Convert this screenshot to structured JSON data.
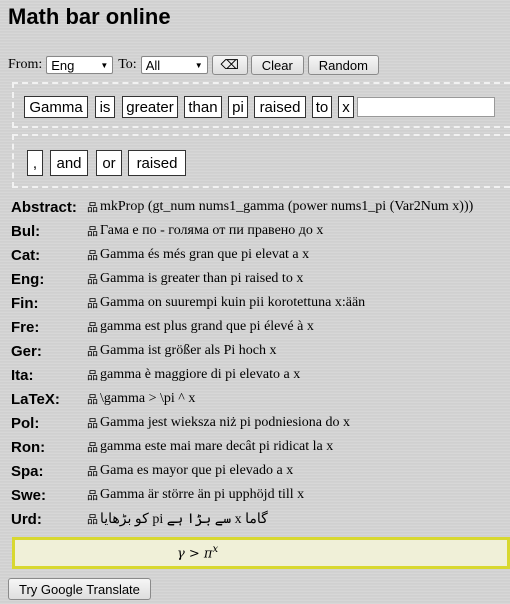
{
  "app": {
    "title": "Math bar online"
  },
  "controls": {
    "from_label": "From:",
    "from_value": "Eng",
    "to_label": "To:",
    "to_value": "All",
    "backspace_label": "⌫",
    "clear_label": "Clear",
    "random_label": "Random"
  },
  "sentence_words": [
    "Gamma",
    "is",
    "greater",
    "than",
    "pi",
    "raised",
    "to",
    "x"
  ],
  "next_words": [
    ",",
    "and",
    "or",
    "raised"
  ],
  "translations": [
    {
      "label": "Abstract:",
      "text": "mkProp (gt_num nums1_gamma (power nums1_pi (Var2Num x)))"
    },
    {
      "label": "Bul:",
      "text": "Гама е по - голяма от пи правено до x"
    },
    {
      "label": "Cat:",
      "text": "Gamma és més gran que pi elevat a x"
    },
    {
      "label": "Eng:",
      "text": "Gamma is greater than pi raised to x"
    },
    {
      "label": "Fin:",
      "text": "Gamma on suurempi kuin pii korotettuna x:ään"
    },
    {
      "label": "Fre:",
      "text": "gamma est plus grand que pi élevé à x"
    },
    {
      "label": "Ger:",
      "text": "Gamma ist größer als Pi hoch x"
    },
    {
      "label": "Ita:",
      "text": "gamma è maggiore di pi elevato a x"
    },
    {
      "label": "LaTeX:",
      "text": "\\gamma > \\pi ^ x"
    },
    {
      "label": "Pol:",
      "text": "Gamma jest wieksza niż pi podniesiona do x"
    },
    {
      "label": "Ron:",
      "text": "gamma este mai mare decât pi ridicat la x"
    },
    {
      "label": "Spa:",
      "text": "Gama es mayor que pi elevado a x"
    },
    {
      "label": "Swe:",
      "text": "Gamma är större än pi upphöjd till x"
    },
    {
      "label": "Urd:",
      "text": "گاما x سے بڑا ہے pi کو بڑھایا"
    }
  ],
  "math_render": {
    "base": "γ > π",
    "exponent": "x"
  },
  "google_button_label": "Try Google Translate"
}
